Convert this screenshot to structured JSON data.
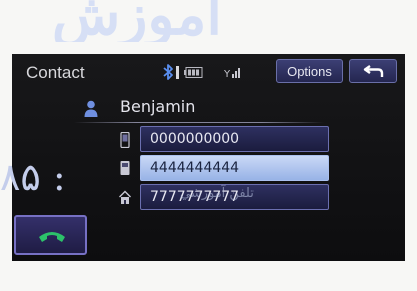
{
  "header": {
    "title": "Contact",
    "options_label": "Options"
  },
  "status_icons": [
    "bluetooth-icon",
    "battery-icon",
    "signal-strength-icon"
  ],
  "contact": {
    "name": "Benjamin",
    "numbers": [
      {
        "type_icon": "mobile-phone-icon",
        "number": "0000000000",
        "selected": false
      },
      {
        "type_icon": "phone-icon",
        "number": "4444444444",
        "selected": true
      },
      {
        "type_icon": "home-icon",
        "number": "7777777777",
        "selected": false
      }
    ]
  },
  "colors": {
    "screen_background": "#121214",
    "button_fill": "#2e3060",
    "button_border": "#6b6fb0",
    "selected_row": "#aec3ee",
    "call_icon": "#2cc26a"
  }
}
